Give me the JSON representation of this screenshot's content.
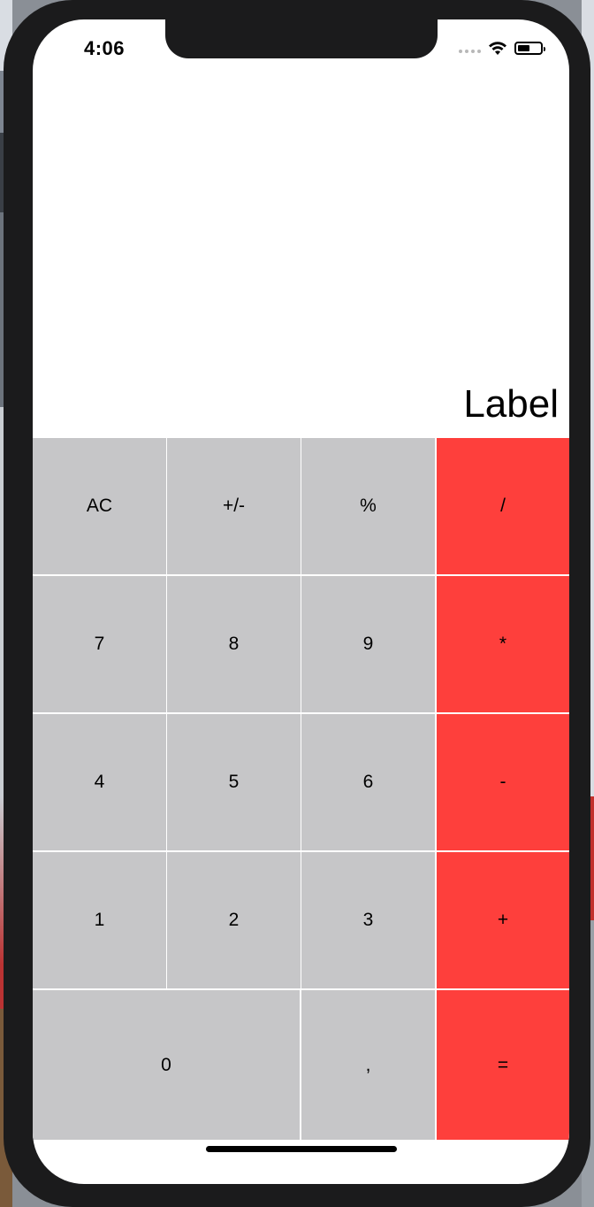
{
  "status_bar": {
    "time": "4:06",
    "icons": [
      "signal-dots-icon",
      "wifi-icon",
      "battery-icon"
    ]
  },
  "display": {
    "label": "Label"
  },
  "keys": {
    "ac": "AC",
    "plus_minus": "+/-",
    "percent": "%",
    "divide": "/",
    "seven": "7",
    "eight": "8",
    "nine": "9",
    "multiply": "*",
    "four": "4",
    "five": "5",
    "six": "6",
    "minus": "-",
    "one": "1",
    "two": "2",
    "three": "3",
    "plus": "+",
    "zero": "0",
    "comma": ",",
    "equals": "="
  },
  "colors": {
    "function_key": "#c6c6c8",
    "operator_key": "#fe3f3c",
    "device_frame": "#1b1b1c"
  }
}
